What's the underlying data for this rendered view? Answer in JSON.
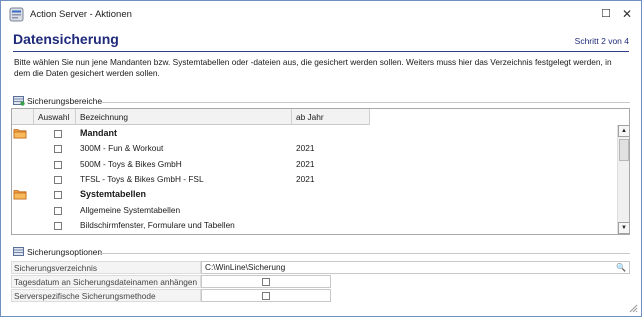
{
  "window": {
    "title": "Action Server - Aktionen",
    "maximize_glyph": "☐",
    "close_glyph": "✕"
  },
  "header": {
    "title": "Datensicherung",
    "step": "Schritt 2 von 4",
    "intro": "Bitte wählen Sie nun jene Mandanten bzw. Systemtabellen oder -dateien aus, die gesichert werden sollen. Weiters muss hier das Verzeichnis festgelegt werden, in dem die Daten gesichert werden sollen."
  },
  "areas": {
    "title": "Sicherungsbereiche",
    "columns": [
      "Auswahl",
      "Bezeichnung",
      "ab Jahr"
    ],
    "rows": [
      {
        "folder": true,
        "bold": true,
        "name": "Mandant",
        "year": ""
      },
      {
        "folder": false,
        "bold": false,
        "name": "300M - Fun & Workout",
        "year": "2021"
      },
      {
        "folder": false,
        "bold": false,
        "name": "500M - Toys & Bikes GmbH",
        "year": "2021"
      },
      {
        "folder": false,
        "bold": false,
        "name": "TFSL - Toys & Bikes GmbH - FSL",
        "year": "2021"
      },
      {
        "folder": true,
        "bold": true,
        "name": "Systemtabellen",
        "year": ""
      },
      {
        "folder": false,
        "bold": false,
        "name": "Allgemeine Systemtabellen",
        "year": ""
      },
      {
        "folder": false,
        "bold": false,
        "name": "Bildschirmfenster, Formulare und Tabellen",
        "year": ""
      }
    ],
    "scroll_up": "▲",
    "scroll_down": "▼"
  },
  "options": {
    "title": "Sicherungsoptionen",
    "directory_label": "Sicherungsverzeichnis",
    "directory_value": "C:\\WinLine\\Sicherung",
    "date_label": "Tagesdatum an Sicherungsdateinamen anhängen",
    "method_label": "Serverspezifische Sicherungsmethode",
    "search_glyph": "🔍"
  },
  "icons": {
    "app": "action-server-icon",
    "folder": "folder-icon",
    "areas_group": "backup-areas-icon",
    "options_group": "backup-options-icon"
  },
  "colors": {
    "heading": "#1f2a7a",
    "border": "#6f8fbf",
    "folder": "#e8892a"
  }
}
